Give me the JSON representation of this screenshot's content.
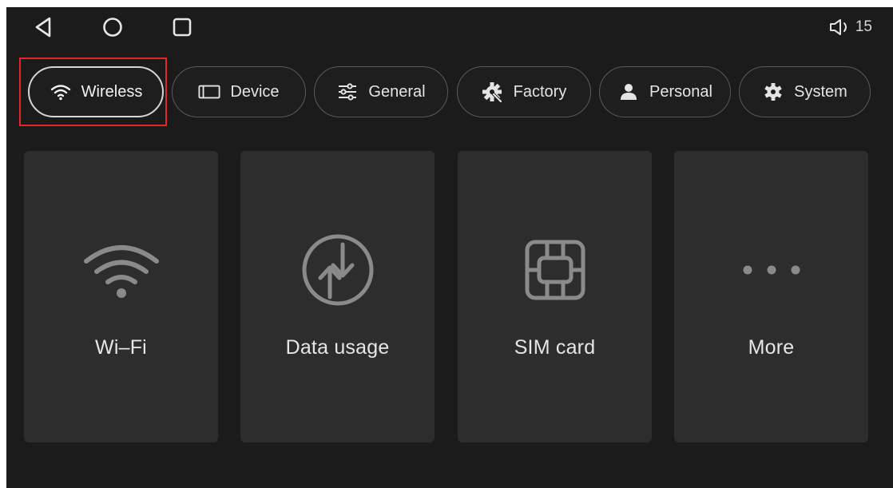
{
  "status_bar": {
    "volume_value": "15"
  },
  "colors": {
    "screen_bg": "#1b1b1c",
    "tile_bg": "#2d2d2e",
    "highlight": "#e8242b"
  },
  "tabs": [
    {
      "label": "Wireless",
      "icon": "wifi-icon",
      "active": true
    },
    {
      "label": "Device",
      "icon": "device-icon",
      "active": false
    },
    {
      "label": "General",
      "icon": "sliders-icon",
      "active": false
    },
    {
      "label": "Factory",
      "icon": "factory-icon",
      "active": false
    },
    {
      "label": "Personal",
      "icon": "person-icon",
      "active": false
    },
    {
      "label": "System",
      "icon": "gear-icon",
      "active": false
    }
  ],
  "tiles": [
    {
      "label": "Wi–Fi",
      "icon": "wifi-icon"
    },
    {
      "label": "Data usage",
      "icon": "data-usage-icon"
    },
    {
      "label": "SIM card",
      "icon": "sim-card-icon"
    },
    {
      "label": "More",
      "icon": "more-icon"
    }
  ]
}
